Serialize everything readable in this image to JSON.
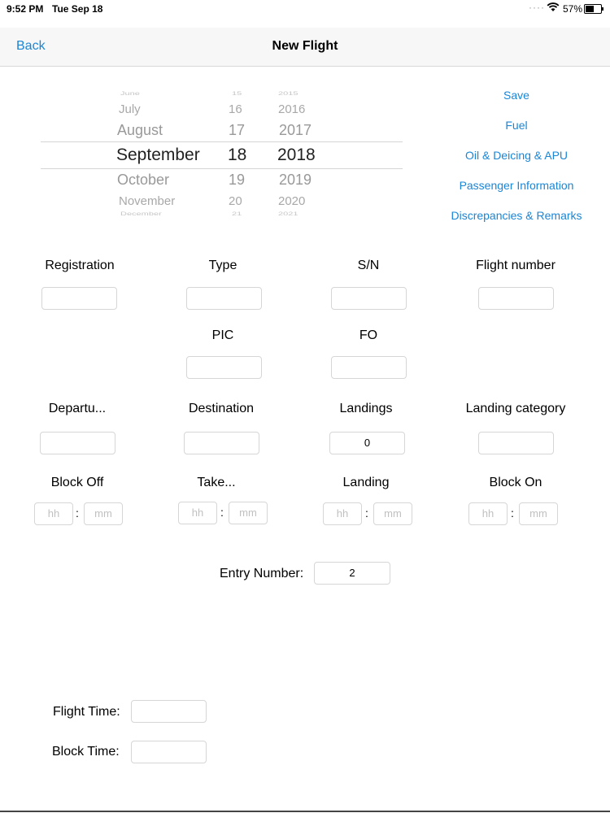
{
  "status_bar": {
    "time": "9:52 PM",
    "date": "Tue Sep 18",
    "battery": "57%",
    "battery_level": 0.57
  },
  "nav": {
    "back_label": "Back",
    "title": "New Flight"
  },
  "date_picker": {
    "months": [
      "June",
      "July",
      "August",
      "September",
      "October",
      "November",
      "December"
    ],
    "days": [
      "15",
      "16",
      "17",
      "18",
      "19",
      "20",
      "21"
    ],
    "years": [
      "2015",
      "2016",
      "2017",
      "2018",
      "2019",
      "2020",
      "2021"
    ],
    "selected": {
      "month": "September",
      "day": "18",
      "year": "2018"
    }
  },
  "side_links": [
    "Save",
    "Fuel",
    "Oil & Deicing & APU",
    "Passenger Information",
    "Discrepancies & Remarks"
  ],
  "form": {
    "registration_label": "Registration",
    "type_label": "Type",
    "sn_label": "S/N",
    "flight_number_label": "Flight number",
    "pic_label": "PIC",
    "fo_label": "FO",
    "departure_label": "Departu...",
    "destination_label": "Destination",
    "landings_label": "Landings",
    "landings_value": "0",
    "landing_category_label": "Landing category",
    "block_off_label": "Block Off",
    "takeoff_label": "Take...",
    "landing_label": "Landing",
    "block_on_label": "Block On",
    "hh_placeholder": "hh",
    "mm_placeholder": "mm",
    "colon": ":",
    "entry_number_label": "Entry Number:",
    "entry_number_value": "2",
    "flight_time_label": "Flight Time:",
    "block_time_label": "Block Time:"
  },
  "colors": {
    "accent": "#1a86d6"
  }
}
